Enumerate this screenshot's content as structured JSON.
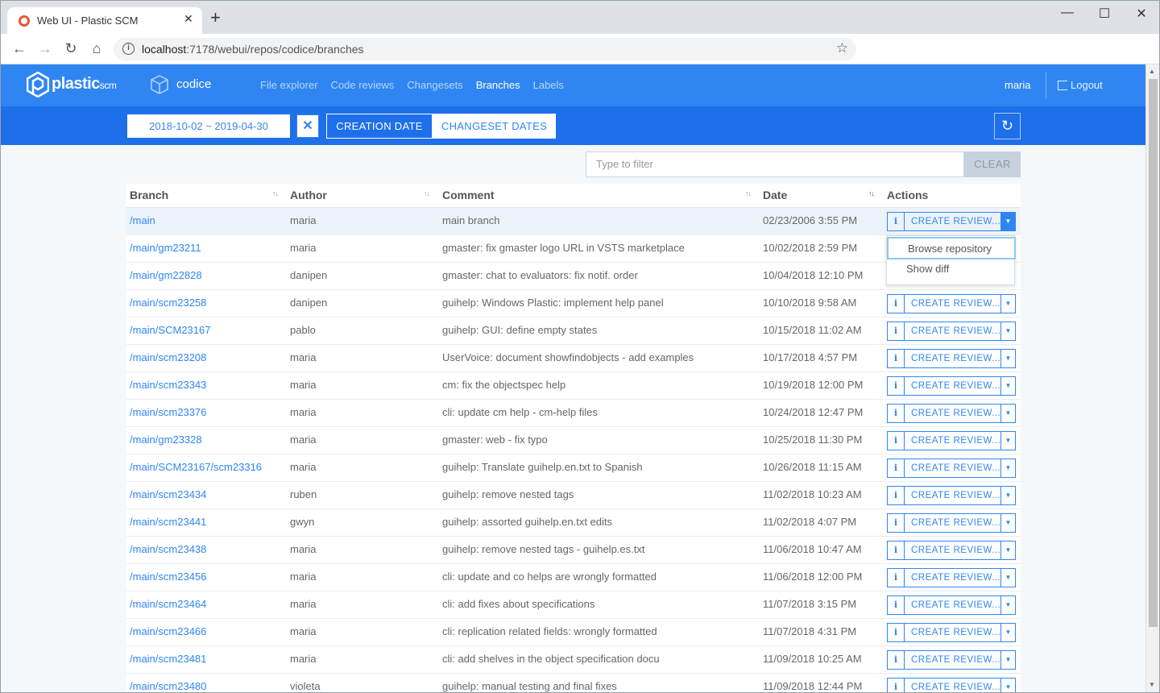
{
  "browser": {
    "tab_title": "Web UI - Plastic SCM",
    "url_host": "localhost",
    "url_rest": ":7178/webui/repos/codice/branches"
  },
  "app": {
    "logo_main": "plastic",
    "logo_sub": "scm",
    "repo_name": "codice",
    "nav": [
      "File explorer",
      "Code reviews",
      "Changesets",
      "Branches",
      "Labels"
    ],
    "active_nav": "Branches",
    "user": "maria",
    "logout_label": "Logout"
  },
  "toolbar": {
    "date_range": "2018-10-02 ~ 2019-04-30",
    "creation_date_label": "CREATION DATE",
    "changeset_dates_label": "CHANGESET DATES"
  },
  "filter": {
    "placeholder": "Type to filter",
    "clear_label": "CLEAR"
  },
  "table": {
    "headers": {
      "branch": "Branch",
      "author": "Author",
      "comment": "Comment",
      "date": "Date",
      "actions": "Actions"
    },
    "action_review_label": "CREATE REVIEW...",
    "rows": [
      {
        "branch": "/main",
        "author": "maria",
        "comment": "main branch",
        "date": "02/23/2006 3:55 PM"
      },
      {
        "branch": "/main/gm23211",
        "author": "maria",
        "comment": "gmaster: fix gmaster logo URL in VSTS marketplace",
        "date": "10/02/2018 2:59 PM"
      },
      {
        "branch": "/main/gm22828",
        "author": "danipen",
        "comment": "gmaster: chat to evaluators: fix notif. order",
        "date": "10/04/2018 12:10 PM"
      },
      {
        "branch": "/main/scm23258",
        "author": "danipen",
        "comment": "guihelp: Windows Plastic: implement help panel",
        "date": "10/10/2018 9:58 AM"
      },
      {
        "branch": "/main/SCM23167",
        "author": "pablo",
        "comment": "guihelp: GUI: define empty states",
        "date": "10/15/2018 11:02 AM"
      },
      {
        "branch": "/main/scm23208",
        "author": "maria",
        "comment": "UserVoice: document showfindobjects - add examples",
        "date": "10/17/2018 4:57 PM"
      },
      {
        "branch": "/main/scm23343",
        "author": "maria",
        "comment": "cm: fix the objectspec help",
        "date": "10/19/2018 12:00 PM"
      },
      {
        "branch": "/main/scm23376",
        "author": "maria",
        "comment": "cli: update cm help - cm-help files",
        "date": "10/24/2018 12:47 PM"
      },
      {
        "branch": "/main/gm23328",
        "author": "maria",
        "comment": "gmaster: web - fix typo",
        "date": "10/25/2018 11:30 PM"
      },
      {
        "branch": "/main/SCM23167/scm23316",
        "author": "maria",
        "comment": "guihelp: Translate guihelp.en.txt to Spanish",
        "date": "10/26/2018 11:15 AM"
      },
      {
        "branch": "/main/scm23434",
        "author": "ruben",
        "comment": "guihelp: remove nested tags",
        "date": "11/02/2018 10:23 AM"
      },
      {
        "branch": "/main/scm23441",
        "author": "gwyn",
        "comment": "guihelp: assorted guihelp.en.txt edits",
        "date": "11/02/2018 4:07 PM"
      },
      {
        "branch": "/main/scm23438",
        "author": "maria",
        "comment": "guihelp: remove nested tags - guihelp.es.txt",
        "date": "11/06/2018 10:47 AM"
      },
      {
        "branch": "/main/scm23456",
        "author": "maria",
        "comment": "cli: update and co helps are wrongly formatted",
        "date": "11/06/2018 12:00 PM"
      },
      {
        "branch": "/main/scm23464",
        "author": "maria",
        "comment": "cli: add fixes about specifications",
        "date": "11/07/2018 3:15 PM"
      },
      {
        "branch": "/main/scm23466",
        "author": "maria",
        "comment": "cli: replication related fields: wrongly formatted",
        "date": "11/07/2018 4:31 PM"
      },
      {
        "branch": "/main/scm23481",
        "author": "maria",
        "comment": "cli: add shelves in the object specification docu",
        "date": "11/09/2018 10:25 AM"
      },
      {
        "branch": "/main/scm23480",
        "author": "violeta",
        "comment": "guihelp: manual testing and final fixes",
        "date": "11/09/2018 12:44 PM"
      }
    ]
  },
  "dropdown": {
    "items": [
      "Browse repository",
      "Show diff"
    ]
  },
  "colors": {
    "header_blue": "#2f86f2",
    "toolbar_blue": "#1e6fea",
    "link_blue": "#2f86f2"
  }
}
